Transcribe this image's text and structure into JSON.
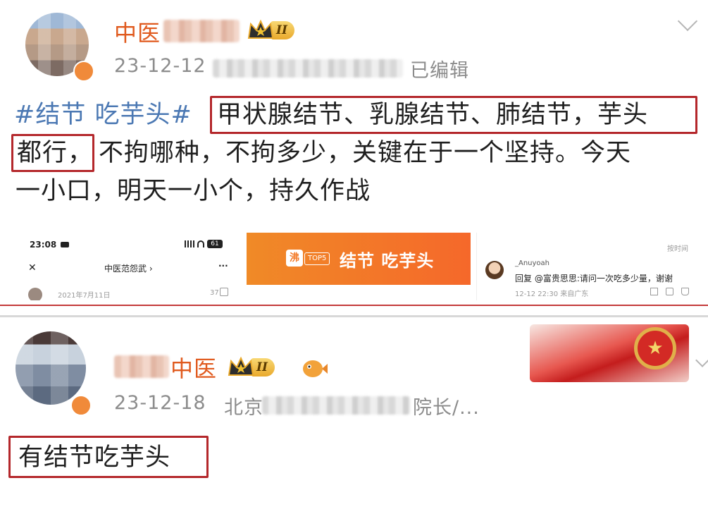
{
  "post1": {
    "username_visible": "中医",
    "vip_level": "II",
    "date": "23-12-12",
    "edited": "已编辑",
    "hashtag": "#结节 吃芋头#",
    "line1_highlight": "甲状腺结节、乳腺结节、肺结节，芋头",
    "line2_highlight": "都行，",
    "line2_rest": "不拘哪种，不拘多少，关键在于一个坚持。今天",
    "line3": "一小口，明天一小个，持久作战",
    "thumb_phone": {
      "time": "23:08",
      "battery": "61",
      "close_glyph": "✕",
      "title": "中医范怨武 ›",
      "more_glyph": "···",
      "date": "2021年7月11日",
      "likes": "37"
    },
    "thumb_topic": {
      "badge": "沸",
      "rank": "TOP5",
      "text": "结节 吃芋头"
    },
    "thumb_comment": {
      "corner": "按时间",
      "user": "_Anuyoah",
      "reply": "回复 @富贵思思:请问一次吃多少量，谢谢",
      "meta": "12-12 22:30 来自广东"
    }
  },
  "post2": {
    "username_visible": "中医",
    "vip_level": "II",
    "date": "23-12-18",
    "location": "北京",
    "title_tail": "院长/...",
    "text": "有结节吃芋头"
  },
  "colors": {
    "username": "#e05a1e",
    "hashtag": "#4b78b3",
    "highlight_box": "#b4272b",
    "meta": "#8c8c8c",
    "topic_bg": "#f37a28"
  }
}
